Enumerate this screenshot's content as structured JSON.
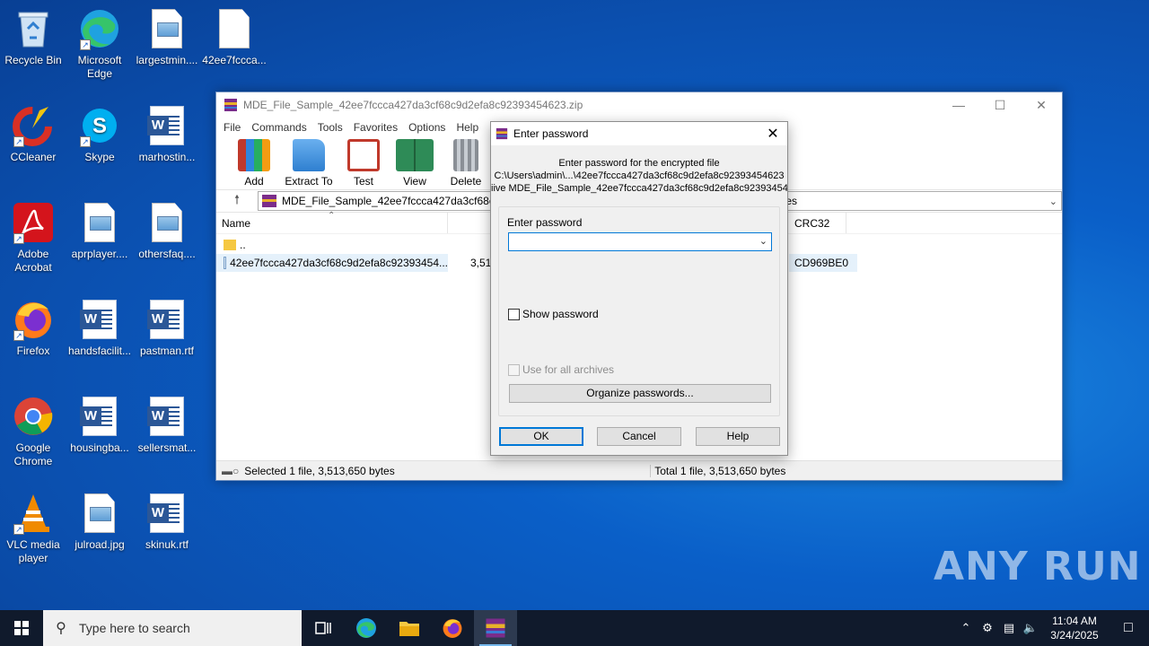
{
  "desktop": {
    "icons": [
      {
        "label": "Recycle Bin"
      },
      {
        "label": "Microsoft Edge"
      },
      {
        "label": "largestmin...."
      },
      {
        "label": "42ee7fccca..."
      },
      {
        "label": "CCleaner"
      },
      {
        "label": "Skype"
      },
      {
        "label": "marhostin..."
      },
      {
        "label": "Adobe Acrobat"
      },
      {
        "label": "aprplayer...."
      },
      {
        "label": "othersfaq...."
      },
      {
        "label": "Firefox"
      },
      {
        "label": "handsfacilit..."
      },
      {
        "label": "pastman.rtf"
      },
      {
        "label": "Google Chrome"
      },
      {
        "label": "housingba..."
      },
      {
        "label": "sellersmat..."
      },
      {
        "label": "VLC media player"
      },
      {
        "label": "julroad.jpg"
      },
      {
        "label": "skinuk.rtf"
      }
    ]
  },
  "winrar": {
    "title": "MDE_File_Sample_42ee7fccca427da3cf68c9d2efa8c92393454623.zip",
    "menu": [
      "File",
      "Commands",
      "Tools",
      "Favorites",
      "Options",
      "Help"
    ],
    "toolbar": [
      "Add",
      "Extract To",
      "Test",
      "View",
      "Delete"
    ],
    "address": "MDE_File_Sample_42ee7fccca427da3cf68c9",
    "address_tail": "ytes",
    "columns": {
      "name": "Name",
      "crc": "CRC32"
    },
    "rows": [
      {
        "name": "..",
        "size": "",
        "crc": ""
      },
      {
        "name": "42ee7fccca427da3cf68c9d2efa8c92393454...",
        "size": "3,51",
        "crc": "CD969BE0"
      }
    ],
    "status_left": "Selected 1 file, 3,513,650 bytes",
    "status_right": "Total 1 file, 3,513,650 bytes"
  },
  "dialog": {
    "title": "Enter password",
    "info_line1": "Enter password for the encrypted file",
    "info_line2": "C:\\Users\\admin\\...\\42ee7fccca427da3cf68c9d2efa8c92393454623",
    "info_line3": "iive MDE_File_Sample_42ee7fccca427da3cf68c9d2efa8c923934546:",
    "password_label": "Enter password",
    "password_value": "",
    "show_password": "Show password",
    "use_all": "Use for all archives",
    "organize": "Organize passwords...",
    "ok": "OK",
    "cancel": "Cancel",
    "help": "Help"
  },
  "taskbar": {
    "search_placeholder": "Type here to search",
    "time": "11:04 AM",
    "date": "3/24/2025"
  },
  "watermark": "ANY RUN"
}
